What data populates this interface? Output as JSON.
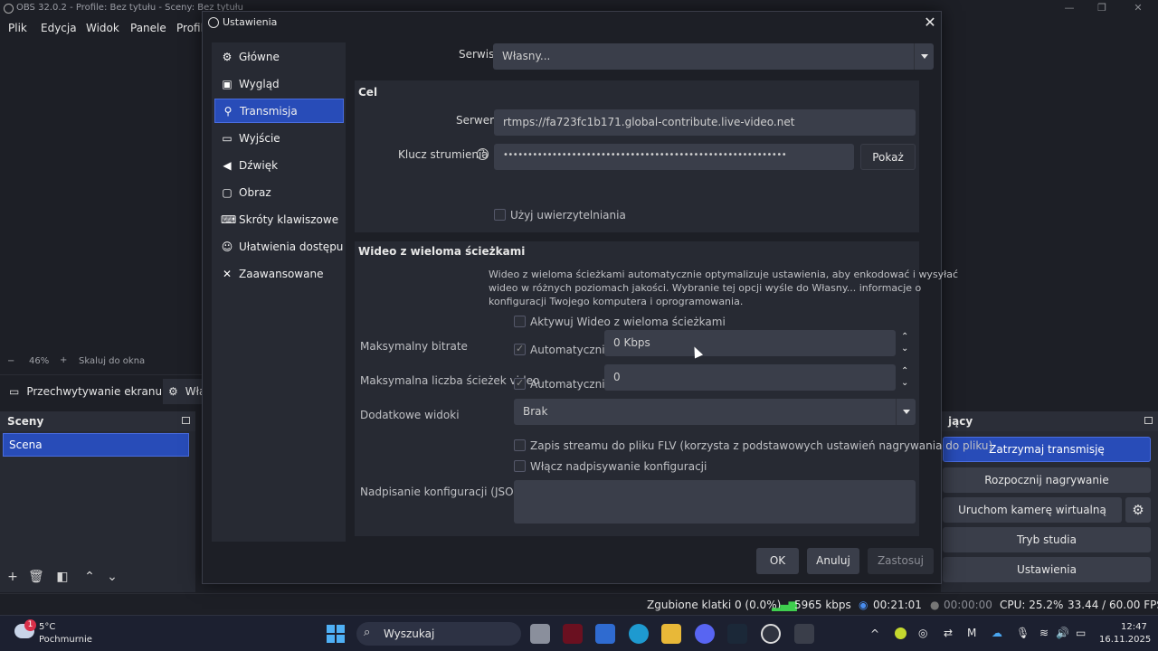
{
  "obs": {
    "title": "OBS 32.0.2 - Profile: Bez tytułu - Sceny: Bez tytułu",
    "menu": [
      "Plik",
      "Edycja",
      "Widok",
      "Panele",
      "Profil"
    ],
    "zoom": {
      "minus": "−",
      "value": "46%",
      "plus": "+",
      "fit": "Skaluj do okna"
    },
    "sources": {
      "capture": "Przechwytywanie ekranu",
      "props": "Wła"
    },
    "scenes": {
      "title": "Sceny",
      "item": "Scena"
    },
    "controls": {
      "title": "jący",
      "stop_stream": "Zatrzymaj transmisję",
      "start_record": "Rozpocznij nagrywanie",
      "virtual_cam": "Uruchom kamerę wirtualną",
      "studio_mode": "Tryb studia",
      "settings": "Ustawienia"
    },
    "status": {
      "dropped": "Zgubione klatki 0 (0.0%)",
      "bitrate": "5965 kbps",
      "stream_time": "00:21:01",
      "record_time": "00:00:00",
      "cpu": "CPU: 25.2%",
      "fps": "33.44 / 60.00 FPS"
    }
  },
  "taskbar": {
    "weather_temp": "5°C",
    "weather_desc": "Pochmurnie",
    "weather_badge": "1",
    "search": "Wyszukaj",
    "time": "12:47",
    "date": "16.11.2025"
  },
  "dialog": {
    "title": "Ustawienia",
    "nav": [
      {
        "label": "Główne",
        "icon": "⚙"
      },
      {
        "label": "Wygląd",
        "icon": "▣"
      },
      {
        "label": "Transmisja",
        "icon": "⚲"
      },
      {
        "label": "Wyjście",
        "icon": "▭"
      },
      {
        "label": "Dźwięk",
        "icon": "◀"
      },
      {
        "label": "Obraz",
        "icon": "▢"
      },
      {
        "label": "Skróty klawiszowe",
        "icon": "⌨"
      },
      {
        "label": "Ułatwienia dostępu",
        "icon": "☺"
      },
      {
        "label": "Zaawansowane",
        "icon": "✕"
      }
    ],
    "service_label": "Serwis",
    "service_value": "Własny...",
    "dest_title": "Cel",
    "server_label": "Serwer",
    "server_value": "rtmps://fa723fc1b171.global-contribute.live-video.net",
    "key_label": "Klucz strumienia",
    "key_value": "••••••••••••••••••••••••••••••••••••••••••••••••••••••••••",
    "show_button": "Pokaż",
    "auth_label": "Użyj uwierzytelniania",
    "multi_title": "Wideo z wieloma ścieżkami",
    "multi_desc_1": "Wideo z wieloma ścieżkami automatycznie optymalizuje ustawienia, aby enkodować i wysyłać",
    "multi_desc_2": "wideo w różnych poziomach jakości. Wybranie tej opcji wyśle do Własny... informacje o",
    "multi_desc_3": "konfiguracji Twojego komputera i oprogramowania.",
    "activate_label": "Aktywuj Wideo z wieloma ścieżkami",
    "max_bitrate_label": "Maksymalny bitrate",
    "auto_label": "Automatycznie",
    "max_bitrate_value": "0 Kbps",
    "max_tracks_label": "Maksymalna liczba ścieżek video",
    "max_tracks_value": "0",
    "extra_views_label": "Dodatkowe widoki",
    "extra_views_value": "Brak",
    "flv_label": "Zapis streamu do pliku FLV (korzysta z podstawowych ustawień nagrywania do pliku)",
    "override_label": "Włącz nadpisywanie konfiguracji",
    "json_label": "Nadpisanie konfiguracji (JSON)",
    "ok": "OK",
    "cancel": "Anuluj",
    "apply": "Zastosuj"
  }
}
